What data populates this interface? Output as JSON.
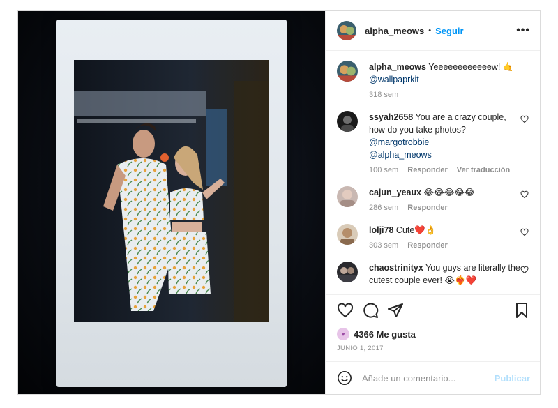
{
  "post": {
    "username": "alpha_meows",
    "follow_label": "Seguir",
    "dot": "•",
    "more_label": "•••"
  },
  "caption": {
    "username": "alpha_meows",
    "text": "Yeeeeeeeeeeeew! 🤙",
    "mention": "@wallpaprkit",
    "time": "318 sem"
  },
  "comments": [
    {
      "username": "ssyah2658",
      "text": "You are a crazy couple, how do you take photos?",
      "mention1": "@margotrobbie",
      "mention2": "@alpha_meows",
      "time": "100 sem",
      "reply": "Responder",
      "translate": "Ver traducción"
    },
    {
      "username": "cajun_yeaux",
      "text": "😂😂😂😂😂",
      "time": "286 sem",
      "reply": "Responder"
    },
    {
      "username": "lolji78",
      "text": "Cute❤️👌",
      "time": "303 sem",
      "reply": "Responder"
    },
    {
      "username": "chaostrinityx",
      "text": "You guys are literally the cutest couple ever! 😭❤️‍🔥❤️"
    }
  ],
  "likes": {
    "label": "4366 Me gusta"
  },
  "date": "JUNIO 1, 2017",
  "add_comment": {
    "placeholder": "Añade un comentario...",
    "publish": "Publicar"
  },
  "colors": {
    "link_blue": "#0095f6",
    "mention": "#00376b",
    "muted": "#8e8e8e",
    "publish_disabled": "#b2dffc"
  }
}
